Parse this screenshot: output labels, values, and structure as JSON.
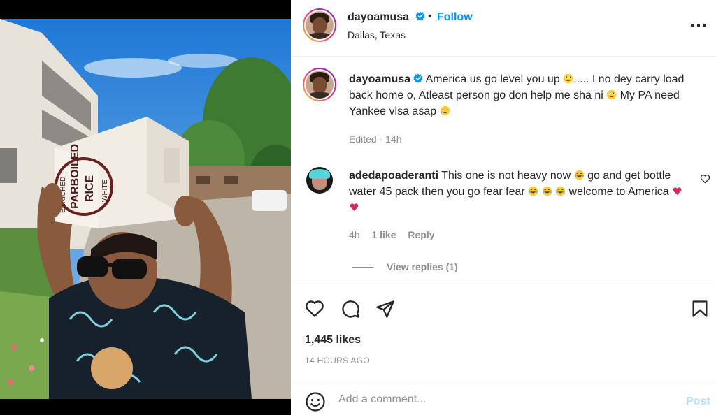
{
  "post": {
    "username": "dayoamusa",
    "follow_label": "Follow",
    "separator": "•",
    "location": "Dallas, Texas",
    "caption_part1": " America us go level you up ",
    "caption_part2": "..... I no dey carry load back home o, Atleast person go don help me sha ni ",
    "caption_part3": " My PA need Yankee visa asap ",
    "edited": "Edited · 14h",
    "likes": "1,445 likes",
    "timestamp": "14 HOURS AGO"
  },
  "photo": {
    "box_text_1": "PARBOILED",
    "box_text_2": "RICE",
    "box_text_3": "ENRICHED",
    "box_text_4": "WHITE"
  },
  "comment": {
    "username": "adedapoaderanti",
    "text_part1": " This one is not heavy now ",
    "text_part2": " go and get bottle water 45 pack then you go fear fear ",
    "text_part3": " welcome to America ",
    "age": "4h",
    "likes": "1 like",
    "reply_label": "Reply",
    "view_replies": "View replies (1)"
  },
  "add_comment": {
    "placeholder": "Add a comment...",
    "post_label": "Post"
  },
  "colors": {
    "accent": "#0095f6",
    "muted": "#8e8e8e",
    "post_disabled": "#b2dffc",
    "verified": "#0095f6"
  },
  "icons": [
    "verified-badge-icon",
    "more-options-icon",
    "heart-icon",
    "comment-icon",
    "share-icon",
    "bookmark-icon",
    "emoji-icon",
    "face-roll-eyes-emoji",
    "rofl-emoji",
    "tears-of-joy-emoji",
    "red-heart-emoji"
  ]
}
